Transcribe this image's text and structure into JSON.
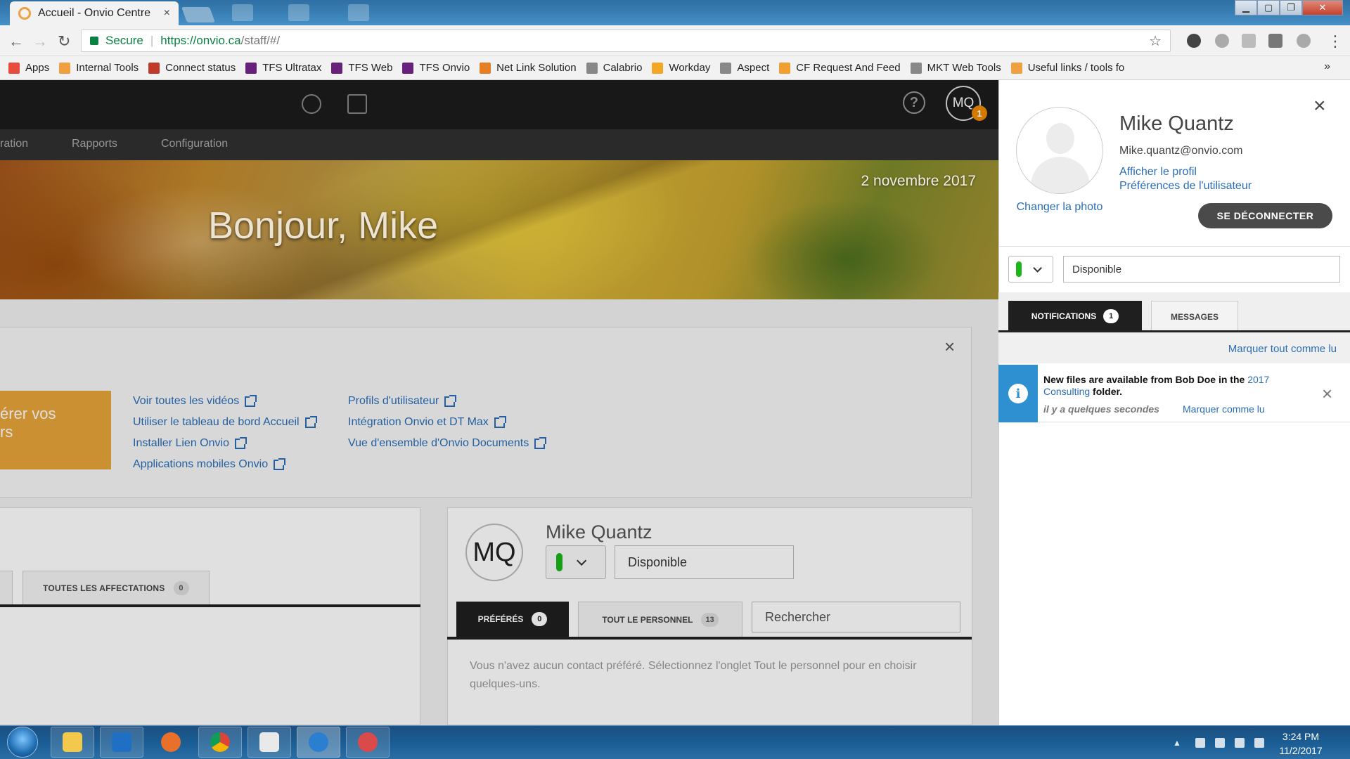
{
  "browser": {
    "tab_title": "Accueil - Onvio Centre",
    "tab_close": "×",
    "secure_label": "Secure",
    "url_host": "https://onvio.ca",
    "url_path": "/staff/#/",
    "bookmarks": [
      {
        "label": "Apps",
        "color": "#e74c3c"
      },
      {
        "label": "Internal Tools",
        "color": "#f0a040"
      },
      {
        "label": "Connect status",
        "color": "#c0392b"
      },
      {
        "label": "TFS Ultratax",
        "color": "#68217a"
      },
      {
        "label": "TFS Web",
        "color": "#68217a"
      },
      {
        "label": "TFS Onvio",
        "color": "#68217a"
      },
      {
        "label": "Net Link Solution",
        "color": "#e67e22"
      },
      {
        "label": "Calabrio",
        "color": "#888888"
      },
      {
        "label": "Workday",
        "color": "#f5a623"
      },
      {
        "label": "Aspect",
        "color": "#888888"
      },
      {
        "label": "CF Request And Feed",
        "color": "#f0a030"
      },
      {
        "label": "MKT Web Tools",
        "color": "#888888"
      },
      {
        "label": "Useful links / tools fo",
        "color": "#f0a040"
      }
    ],
    "bookmarks_more": "»"
  },
  "app": {
    "header": {
      "avatar_initials": "MQ",
      "notif_count": "1",
      "help_label": "?"
    },
    "nav": {
      "item_partial": "ration",
      "item_reports": "Rapports",
      "item_config": "Configuration"
    },
    "hero": {
      "greeting": "Bonjour, Mike",
      "date": "2 novembre 2017"
    },
    "info_card": {
      "close": "×",
      "orange_line1": "érer vos",
      "orange_line2": "rs",
      "links_col1": [
        "Voir toutes les vidéos",
        "Utiliser le tableau de bord Accueil",
        "Installer Lien Onvio",
        "Applications mobiles Onvio"
      ],
      "links_col2": [
        "Profils d'utilisateur",
        "Intégration Onvio et DT Max",
        "Vue d'ensemble d'Onvio Documents"
      ]
    },
    "assignments": {
      "tab_label": "TOUTES LES AFFECTATIONS",
      "tab_count": "0"
    },
    "contacts": {
      "initials": "MQ",
      "name": "Mike Quantz",
      "status_value": "Disponible",
      "tab_favorites": "PRÉFÉRÉS",
      "tab_favorites_count": "0",
      "tab_all": "TOUT LE PERSONNEL",
      "tab_all_count": "13",
      "search_placeholder": "Rechercher",
      "empty_message": "Vous n'avez aucun contact préféré. Sélectionnez l'onglet Tout le personnel pour en choisir quelques-uns."
    }
  },
  "panel": {
    "change_photo": "Changer la photo",
    "name": "Mike Quantz",
    "email": "Mike.quantz@onvio.com",
    "view_profile": "Afficher le profil",
    "user_prefs": "Préférences de l'utilisateur",
    "logout": "SE DÉCONNECTER",
    "close": "×",
    "status_value": "Disponible",
    "tab_notifications": "NOTIFICATIONS",
    "tab_notifications_count": "1",
    "tab_messages": "MESSAGES",
    "mark_all": "Marquer tout comme lu",
    "notification": {
      "text_before": "New files are available from Bob Doe in the",
      "folder_link": "2017 Consulting",
      "text_after": "folder.",
      "time": "il y a quelques secondes",
      "mark_read": "Marquer comme lu",
      "close": "×"
    }
  },
  "taskbar": {
    "time": "3:24 PM",
    "date": "11/2/2017"
  },
  "colors": {
    "status_available": "#1bb41b",
    "accent_orange": "#e8a43a",
    "link_blue": "#2a6db5",
    "notif_blue": "#2e90d0"
  }
}
